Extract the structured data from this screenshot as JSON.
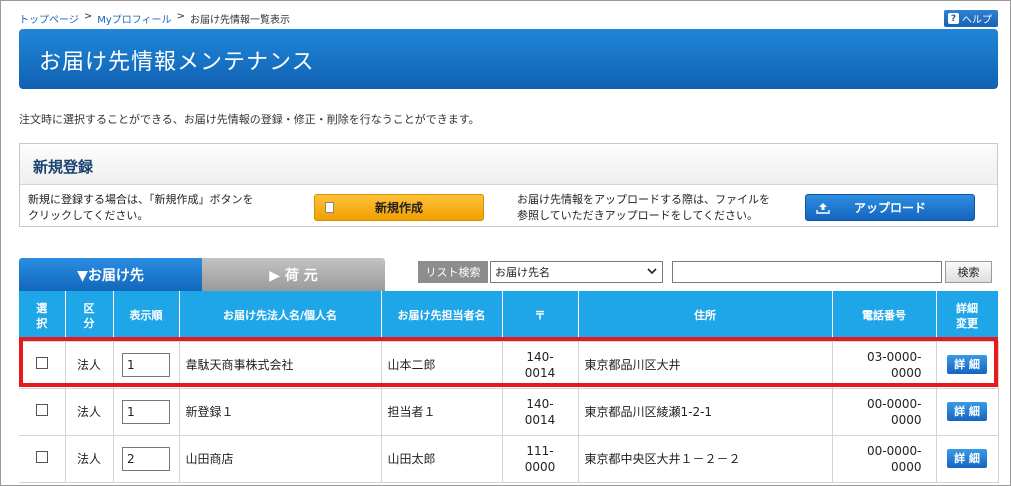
{
  "breadcrumb": {
    "items": [
      "トップページ",
      "Myプロフィール",
      "お届け先情報一覧表示"
    ],
    "separator": ">"
  },
  "help": {
    "icon": "?",
    "label": "ヘルプ"
  },
  "page": {
    "title": "お届け先情報メンテナンス",
    "description": "注文時に選択することができる、お届け先情報の登録・修正・削除を行なうことができます。"
  },
  "registration": {
    "heading": "新規登録",
    "new_line1": "新規に登録する場合は、「新規作成」ボタンを",
    "new_line2": "クリックしてください。",
    "new_button": "新規作成",
    "upload_line1": "お届け先情報をアップロードする際は、ファイルを",
    "upload_line2": "参照していただきアップロードをしてください。",
    "upload_button": "アップロード"
  },
  "tabs": {
    "active": "▼お届け先",
    "inactive": "▶ 荷 元"
  },
  "search": {
    "label": "リスト検索",
    "selected": "お届け先名",
    "button": "検索",
    "value": ""
  },
  "table": {
    "headers": {
      "select": [
        "選",
        "択"
      ],
      "kubun": [
        "区",
        "分"
      ],
      "order": "表示順",
      "name": "お届け先法人名/個人名",
      "contact": "お届け先担当者名",
      "zip": "〒",
      "address": "住所",
      "phone": "電話番号",
      "detail": [
        "詳細",
        "変更"
      ]
    },
    "rows": [
      {
        "kubun": "法人",
        "order": "1",
        "name": "韋駄天商事株式会社",
        "contact": "山本二郎",
        "zip1": "140-",
        "zip2": "0014",
        "address": "東京都品川区大井",
        "phone1": "03-0000-",
        "phone2": "0000",
        "detail": "詳 細"
      },
      {
        "kubun": "法人",
        "order": "1",
        "name": "新登録１",
        "contact": "担当者１",
        "zip1": "140-",
        "zip2": "0014",
        "address": "東京都品川区綾瀬1-2-1",
        "phone1": "00-0000-",
        "phone2": "0000",
        "detail": "詳 細"
      },
      {
        "kubun": "法人",
        "order": "2",
        "name": "山田商店",
        "contact": "山田太郎",
        "zip1": "111-",
        "zip2": "0000",
        "address": "東京都中央区大井１－２－２",
        "phone1": "00-0000-",
        "phone2": "0000",
        "detail": "詳 細"
      }
    ]
  },
  "colors": {
    "accent": "#1fa6e8",
    "banner": "#1161b3",
    "highlight": "#e8191b",
    "new_button": "#f0a000"
  }
}
